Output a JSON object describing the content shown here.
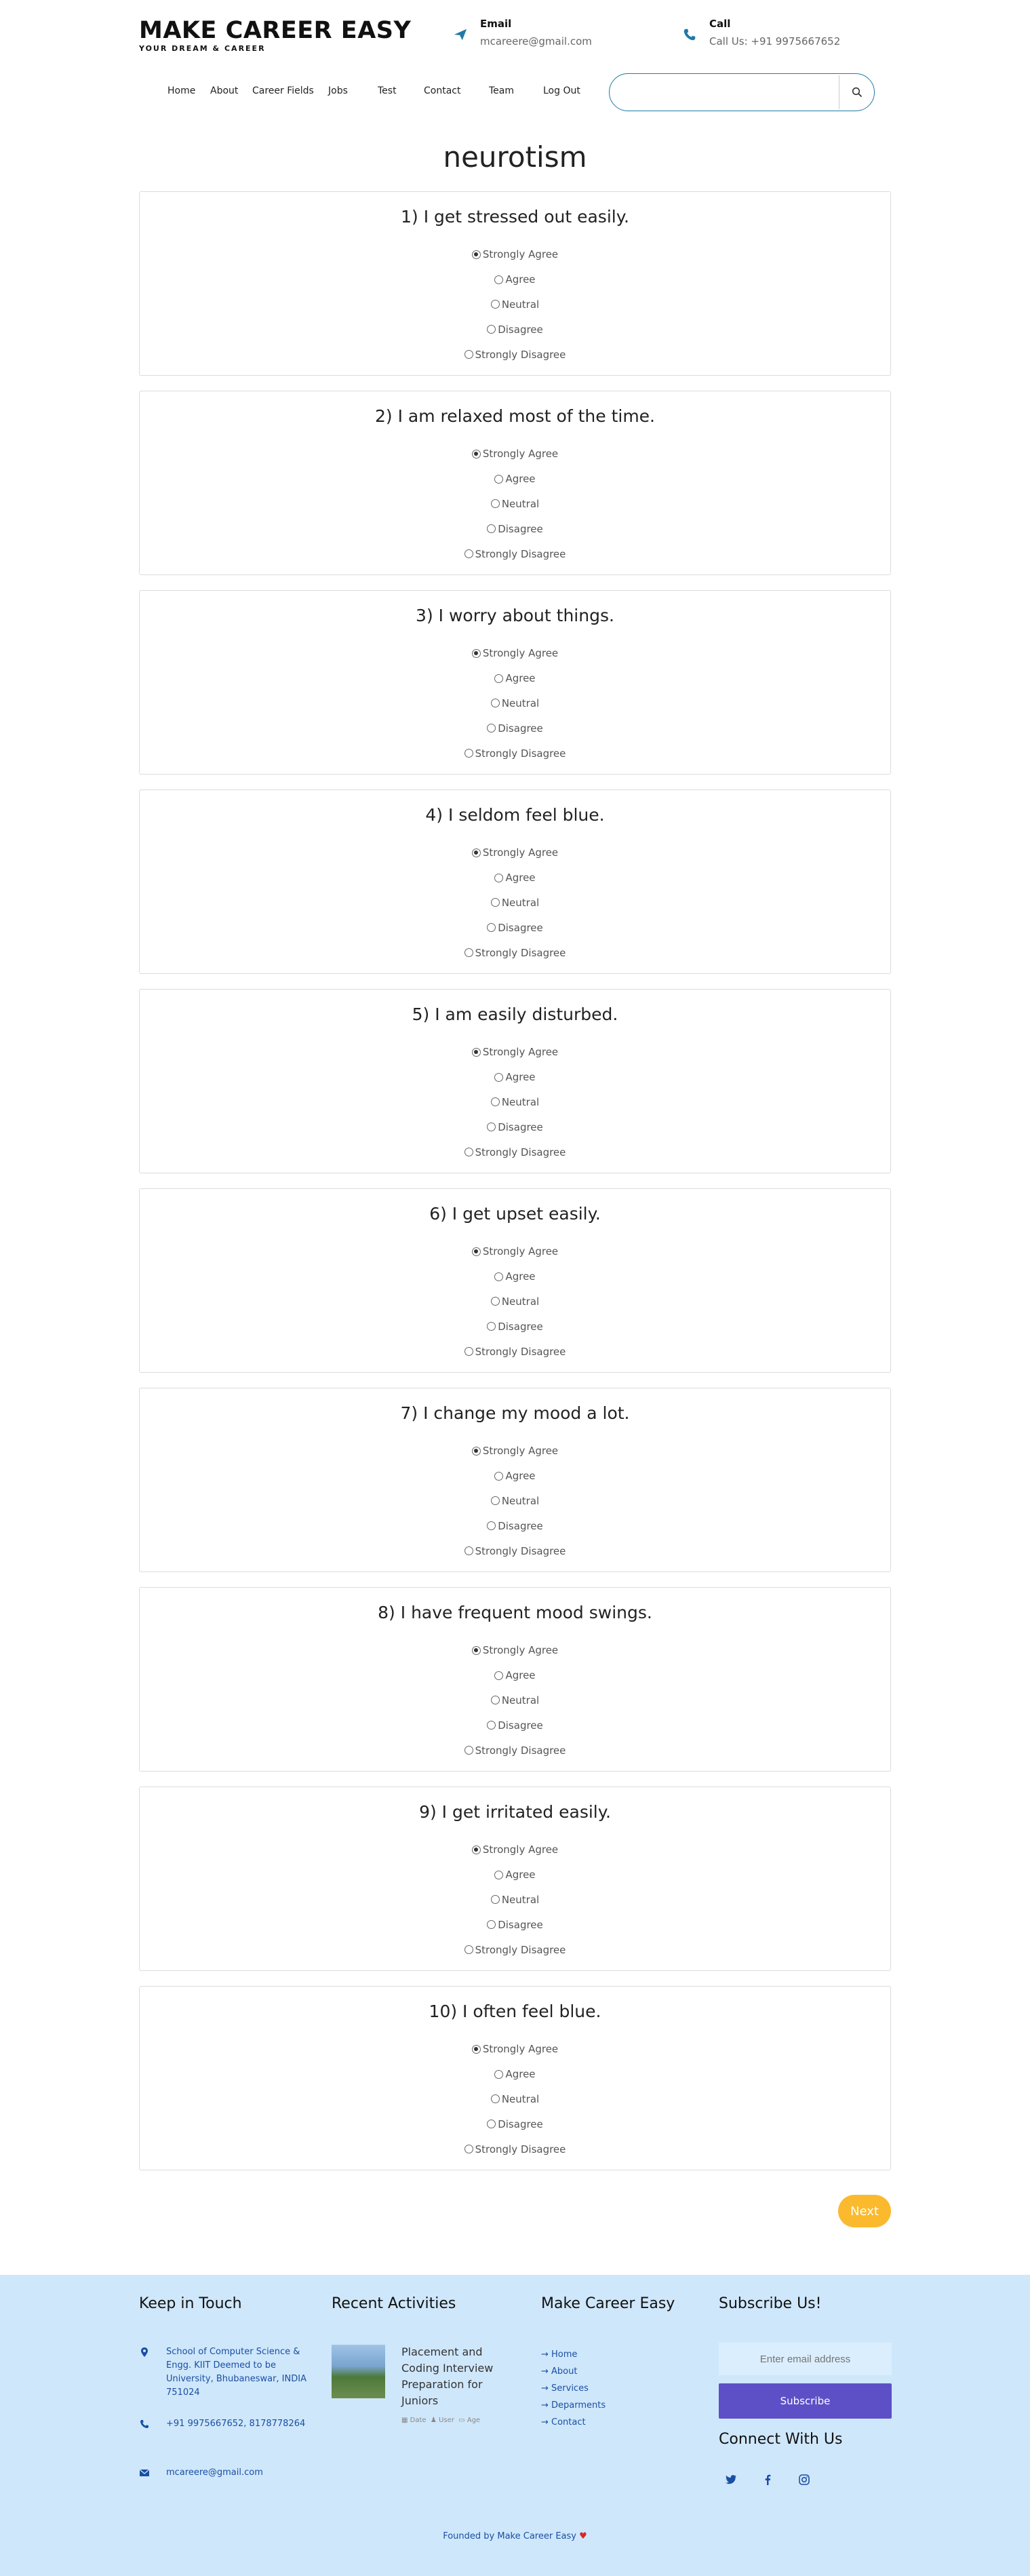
{
  "brand": {
    "name": "MAKE CAREER EASY",
    "tagline": "YOUR DREAM & CAREER"
  },
  "contact": {
    "email_title": "Email",
    "email_value": "mcareere@gmail.com",
    "call_title": "Call",
    "call_value": "Call Us: +91 9975667652"
  },
  "nav": [
    "Home",
    "About",
    "Career Fields",
    "Jobs",
    "Test",
    "Contact",
    "Team",
    "Log Out"
  ],
  "search": {
    "placeholder": ""
  },
  "page_title": "neurotism",
  "options": [
    "Strongly Agree",
    "Agree",
    "Neutral",
    "Disagree",
    "Strongly Disagree"
  ],
  "questions": [
    {
      "text": "1) I get stressed out easily.",
      "selected": 0
    },
    {
      "text": "2) I am relaxed most of the time.",
      "selected": 0
    },
    {
      "text": "3) I worry about things.",
      "selected": 0
    },
    {
      "text": "4) I seldom feel blue.",
      "selected": 0
    },
    {
      "text": "5) I am easily disturbed.",
      "selected": 0
    },
    {
      "text": "6) I get upset easily.",
      "selected": 0
    },
    {
      "text": "7) I change my mood a lot.",
      "selected": 0
    },
    {
      "text": "8) I have frequent mood swings.",
      "selected": 0
    },
    {
      "text": "9) I get irritated easily.",
      "selected": 0
    },
    {
      "text": "10) I often feel blue.",
      "selected": 0
    }
  ],
  "next_label": "Next",
  "footer": {
    "keep_title": "Keep in Touch",
    "address": "School of Computer Science & Engg. KIIT Deemed to be University, Bhubaneswar, INDIA 751024",
    "phone": "+91 9975667652, 8178778264",
    "email": "mcareere@gmail.com",
    "recent_title": "Recent Activities",
    "activity_title": "Placement and Coding Interview Preparation for Juniors",
    "activity_meta": [
      "Date",
      "User",
      "Age"
    ],
    "mce_title": "Make Career Easy",
    "links": [
      "Home",
      "About",
      "Services",
      "Deparments",
      "Contact"
    ],
    "subscribe_title": "Subscribe Us!",
    "subscribe_placeholder": "Enter email address",
    "subscribe_button": "Subscribe",
    "connect_title": "Connect With Us",
    "credit": "Founded by Make Career Easy"
  },
  "colors": {
    "accent": "#1f7aa8",
    "next": "#fbb92d",
    "footer_bg": "#cfe7fb",
    "subscribe": "#5d50c6",
    "link": "#1a4fa3"
  }
}
